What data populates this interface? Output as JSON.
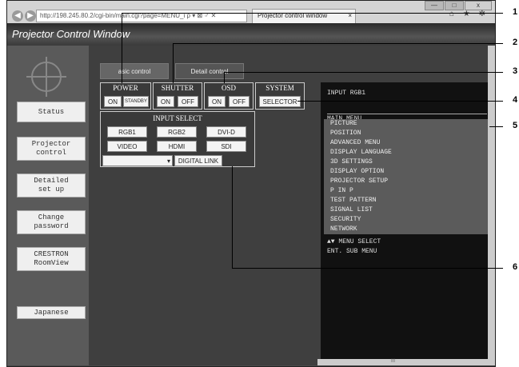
{
  "browser": {
    "url": "http://198.245.80.2/cgi-bin/main.cgi?page=MENU_i",
    "url_icons": "ρ ▾ ⊠ ♂ ✕",
    "tab_title": "Projector control window",
    "tab_close": "×",
    "right_icons": "⌂ ★ ✲",
    "win_min": "—",
    "win_max": "□",
    "win_close": "x"
  },
  "app_title": "Projector Control Window",
  "sidebar": {
    "items": [
      {
        "label": "Status"
      },
      {
        "label": "Projector\ncontrol"
      },
      {
        "label": "Detailed\nset up"
      },
      {
        "label": "Change\npassword"
      },
      {
        "label": "CRESTRON\nRoomView"
      },
      {
        "label": "Japanese"
      }
    ]
  },
  "tabs": [
    {
      "label": "asic control"
    },
    {
      "label": "Detail control"
    }
  ],
  "power": {
    "title": "POWER",
    "on": "ON",
    "standby": "STANDBY"
  },
  "shutter": {
    "title": "SHUTTER",
    "on": "ON",
    "off": "OFF"
  },
  "osd": {
    "title": "OSD",
    "on": "ON",
    "off": "OFF"
  },
  "system": {
    "title": "SYSTEM",
    "selector": "SELECTOR"
  },
  "input_select": {
    "title": "INPUT SELECT",
    "buttons": [
      "RGB1",
      "RGB2",
      "DVI-D",
      "VIDEO",
      "HDMI",
      "SDI"
    ],
    "digital_link": "DIGITAL LINK",
    "dropdown_value": ""
  },
  "osd_screen": {
    "header": "INPUT RGB1",
    "main_menu": "MAIN MENU",
    "items": [
      "PICTURE",
      "POSITION",
      "ADVANCED MENU",
      "DISPLAY LANGUAGE",
      "3D SETTINGS",
      "DISPLAY OPTION",
      "PROJECTOR SETUP",
      "P IN P",
      "TEST PATTERN",
      "SIGNAL LIST",
      "SECURITY",
      "NETWORK"
    ],
    "footer1": "▲▼ MENU SELECT",
    "footer2": "ENT. SUB MENU"
  },
  "scroll_mid": "III",
  "callouts": [
    "1",
    "2",
    "3",
    "4",
    "5",
    "6"
  ]
}
